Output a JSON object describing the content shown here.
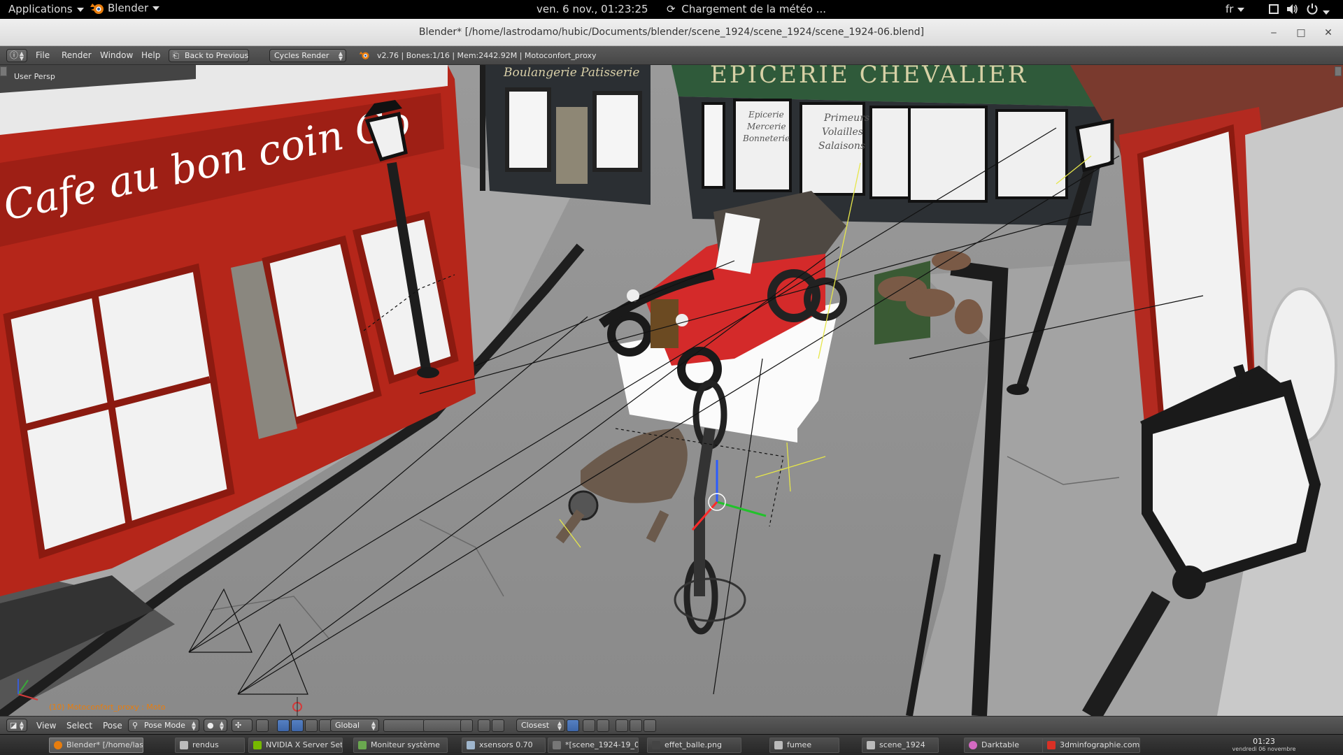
{
  "topbar": {
    "applications": "Applications",
    "app_name": "Blender",
    "datetime": "ven.  6 nov., 01:23:25",
    "weather": "Chargement de la météo ...",
    "lang": "fr"
  },
  "window": {
    "title": "Blender* [/home/lastrodamo/hubic/Documents/blender/scene_1924/scene_1924/scene_1924-06.blend]",
    "minimize": "‒",
    "maximize": "□",
    "close": "✕"
  },
  "info_header": {
    "menus": [
      "File",
      "Render",
      "Window",
      "Help"
    ],
    "back_button": "Back to Previous",
    "render_engine": "Cycles Render",
    "stats": "v2.76 | Bones:1/16  | Mem:2442.92M | Motoconfort_proxy"
  },
  "viewport": {
    "view_label": "User Persp",
    "object_label": "(10) Motoconfort_proxy : Moto",
    "signs": {
      "cafe": "Cafe au bon coin Co",
      "epicerie": "EPICERIE CHEVALIER",
      "boulangerie": "Boulangerie Patisserie",
      "window_text": [
        "Epicerie",
        "Mercerie",
        "Bonneterie",
        "Primeurs",
        "Volailles",
        "Salaisons"
      ]
    }
  },
  "view_header": {
    "menus": [
      "View",
      "Select",
      "Pose"
    ],
    "mode": "Pose Mode",
    "orientation": "Global",
    "snap": "Closest"
  },
  "taskbar": {
    "tasks": [
      {
        "label": "Blender* [/home/las...",
        "color": "#e87d0d"
      },
      {
        "label": "rendus",
        "color": "#bbbbbb"
      },
      {
        "label": "NVIDIA X Server Sett...",
        "color": "#76b900"
      },
      {
        "label": "Moniteur système",
        "color": "#6aa84f"
      },
      {
        "label": "xsensors 0.70",
        "color": "#9fb6cd"
      },
      {
        "label": "*[scene_1924-19_02...",
        "color": "#777777"
      },
      {
        "label": "effet_balle.png",
        "color": "#444444"
      },
      {
        "label": "fumee",
        "color": "#bbbbbb"
      },
      {
        "label": "scene_1924",
        "color": "#bbbbbb"
      },
      {
        "label": "Darktable",
        "color": "#d36ac2"
      },
      {
        "label": "3dminfographie.com...",
        "color": "#d93025"
      }
    ],
    "clock_time": "01:23",
    "clock_date": "vendredi 06 novembre"
  },
  "colors": {
    "cafe_red": "#b5261a",
    "epicerie_green": "#2f5a3a",
    "car_red": "#d42a2a",
    "blender_orange": "#e87d0d",
    "active_blue": "#4a74b8"
  }
}
